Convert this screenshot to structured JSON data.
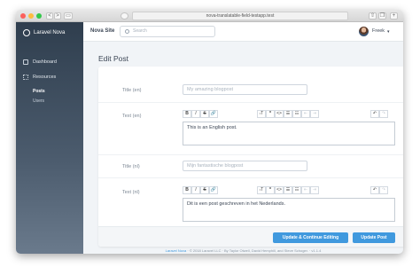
{
  "browser": {
    "url": "nova-translatable-field-testapp.test",
    "traffic_lights": [
      "#fc605c",
      "#fdbc40",
      "#34c84a"
    ],
    "nav_glyphs": {
      "back": "<",
      "forward": ">",
      "sidebar_toggle": "▭",
      "share": "⇧",
      "tabs": "❐",
      "add": "+"
    }
  },
  "sidebar": {
    "logo_text": "Laravel Nova",
    "items": [
      {
        "label": "Dashboard",
        "icon": "dashboard-icon"
      },
      {
        "label": "Resources",
        "icon": "resources-icon"
      }
    ],
    "sub_items": [
      {
        "label": "Posts",
        "active": true
      },
      {
        "label": "Users",
        "active": false
      }
    ]
  },
  "topbar": {
    "site_name": "Nova Site",
    "search_placeholder": "Search",
    "user_name": "Freek",
    "caret": "▾"
  },
  "page": {
    "title": "Edit Post",
    "fields": [
      {
        "label": "Title (en)",
        "type": "text",
        "placeholder": "My amazing blogpost"
      },
      {
        "label": "Text (en)",
        "type": "trix",
        "value": "This is an English post."
      },
      {
        "label": "Title (nl)",
        "type": "text",
        "placeholder": "Mijn fantastische blogpost"
      },
      {
        "label": "Text (nl)",
        "type": "trix",
        "value": "Dit is een post geschreven in het Nederlands."
      }
    ],
    "toolbar_glyphs": [
      "B",
      "I",
      "S",
      "🔗",
      "ₜT",
      "❞",
      "<>",
      "☰",
      "☷",
      "⇤",
      "⇥",
      "↶",
      "↷"
    ]
  },
  "actions": {
    "update_continue": "Update & Continue Editing",
    "update": "Update Post",
    "accent": "#4099de"
  },
  "footer": {
    "link": "Laravel Nova",
    "text": "· © 2018 Laravel LLC · By Taylor Otwell, David Hemphill, and Steve Schoger. · v1.1.4"
  }
}
